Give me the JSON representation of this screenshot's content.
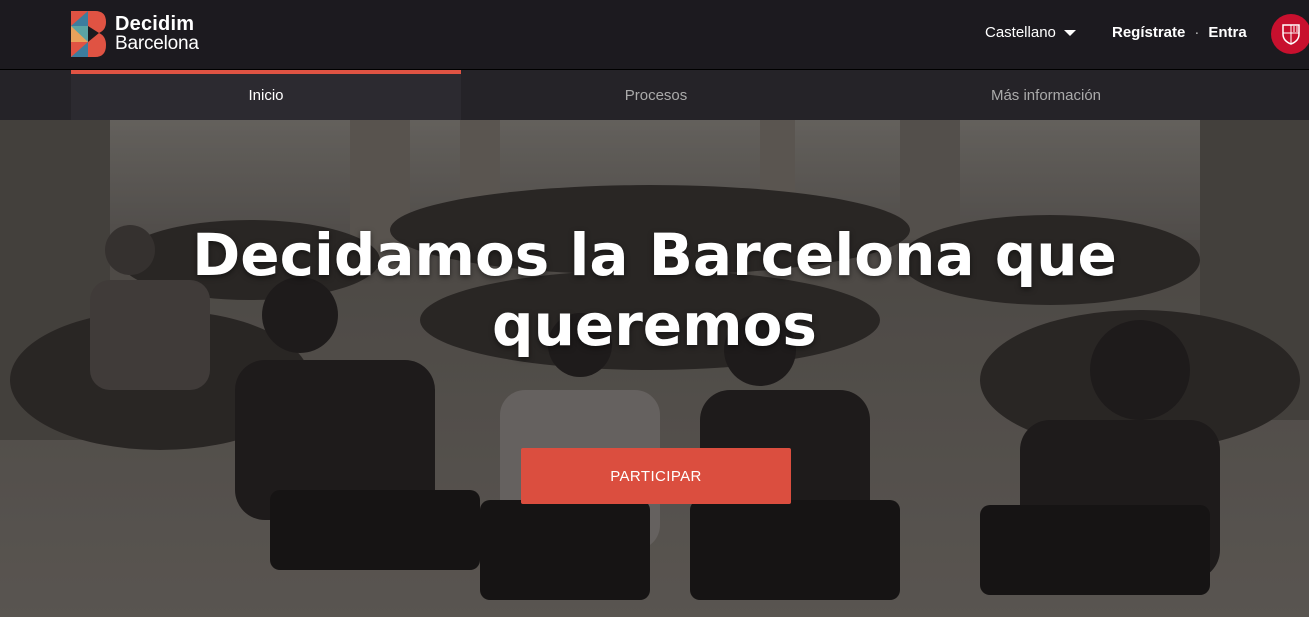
{
  "header": {
    "logo": {
      "line1": "Decidim",
      "line2": "Barcelona"
    },
    "language": {
      "selected": "Castellano",
      "icon": "caret-down-icon"
    },
    "auth": {
      "register": "Regístrate",
      "separator": "·",
      "login": "Entra"
    },
    "city_badge_icon": "barcelona-city-seal-icon"
  },
  "nav": {
    "items": [
      {
        "label": "Inicio",
        "active": true
      },
      {
        "label": "Procesos",
        "active": false
      },
      {
        "label": "Más información",
        "active": false
      }
    ]
  },
  "hero": {
    "title_line1": "Decidamos la Barcelona que",
    "title_line2": "queremos",
    "cta_label": "PARTICIPAR"
  },
  "colors": {
    "topbar_bg": "#1c1a1f",
    "nav_bg": "#252328",
    "accent": "#db4e3f",
    "city_red": "#c8102e"
  }
}
